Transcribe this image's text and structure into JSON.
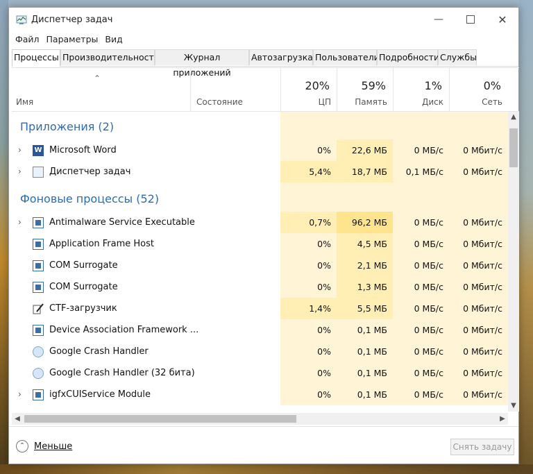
{
  "window": {
    "title": "Диспетчер задач"
  },
  "menu": [
    "Файл",
    "Параметры",
    "Вид"
  ],
  "tabs": [
    {
      "label": "Процессы"
    },
    {
      "label": "Производительность"
    },
    {
      "label": "Журнал приложений"
    },
    {
      "label": "Автозагрузка"
    },
    {
      "label": "Пользователи"
    },
    {
      "label": "Подробности"
    },
    {
      "label": "Службы"
    }
  ],
  "columns": {
    "name": "Имя",
    "status": "Состояние",
    "cpu": {
      "pct": "20%",
      "label": "ЦП"
    },
    "mem": {
      "pct": "59%",
      "label": "Память"
    },
    "disk": {
      "pct": "1%",
      "label": "Диск"
    },
    "net": {
      "pct": "0%",
      "label": "Сеть"
    }
  },
  "groups": {
    "apps": "Приложения (2)",
    "background": "Фоновые процессы (52)"
  },
  "rows": [
    {
      "name": "Microsoft Word",
      "cpu": "0%",
      "mem": "22,6 МБ",
      "disk": "0 МБ/с",
      "net": "0 Мбит/с"
    },
    {
      "name": "Диспетчер задач",
      "cpu": "5,4%",
      "mem": "18,7 МБ",
      "disk": "0,1 МБ/с",
      "net": "0 Мбит/с"
    },
    {
      "name": "Antimalware Service Executable",
      "cpu": "0,7%",
      "mem": "96,2 МБ",
      "disk": "0 МБ/с",
      "net": "0 Мбит/с"
    },
    {
      "name": "Application Frame Host",
      "cpu": "0%",
      "mem": "4,5 МБ",
      "disk": "0 МБ/с",
      "net": "0 Мбит/с"
    },
    {
      "name": "COM Surrogate",
      "cpu": "0%",
      "mem": "2,1 МБ",
      "disk": "0 МБ/с",
      "net": "0 Мбит/с"
    },
    {
      "name": "COM Surrogate",
      "cpu": "0%",
      "mem": "1,3 МБ",
      "disk": "0 МБ/с",
      "net": "0 Мбит/с"
    },
    {
      "name": "CTF-загрузчик",
      "cpu": "1,4%",
      "mem": "5,5 МБ",
      "disk": "0 МБ/с",
      "net": "0 Мбит/с"
    },
    {
      "name": "Device Association Framework ...",
      "cpu": "0%",
      "mem": "0,1 МБ",
      "disk": "0 МБ/с",
      "net": "0 Мбит/с"
    },
    {
      "name": "Google Crash Handler",
      "cpu": "0%",
      "mem": "0,1 МБ",
      "disk": "0 МБ/с",
      "net": "0 Мбит/с"
    },
    {
      "name": "Google Crash Handler (32 бита)",
      "cpu": "0%",
      "mem": "0,1 МБ",
      "disk": "0 МБ/с",
      "net": "0 Мбит/с"
    },
    {
      "name": "igfxCUIService Module",
      "cpu": "0%",
      "mem": "0,1 МБ",
      "disk": "0 МБ/с",
      "net": "0 Мбит/с"
    }
  ],
  "footer": {
    "less": "Меньше",
    "end_task": "Снять задачу"
  },
  "colors": {
    "accent": "#2b6cb3",
    "heat_light": "#fff4d6",
    "heat_mid": "#ffefb5",
    "heat_strong": "#fde48d"
  }
}
